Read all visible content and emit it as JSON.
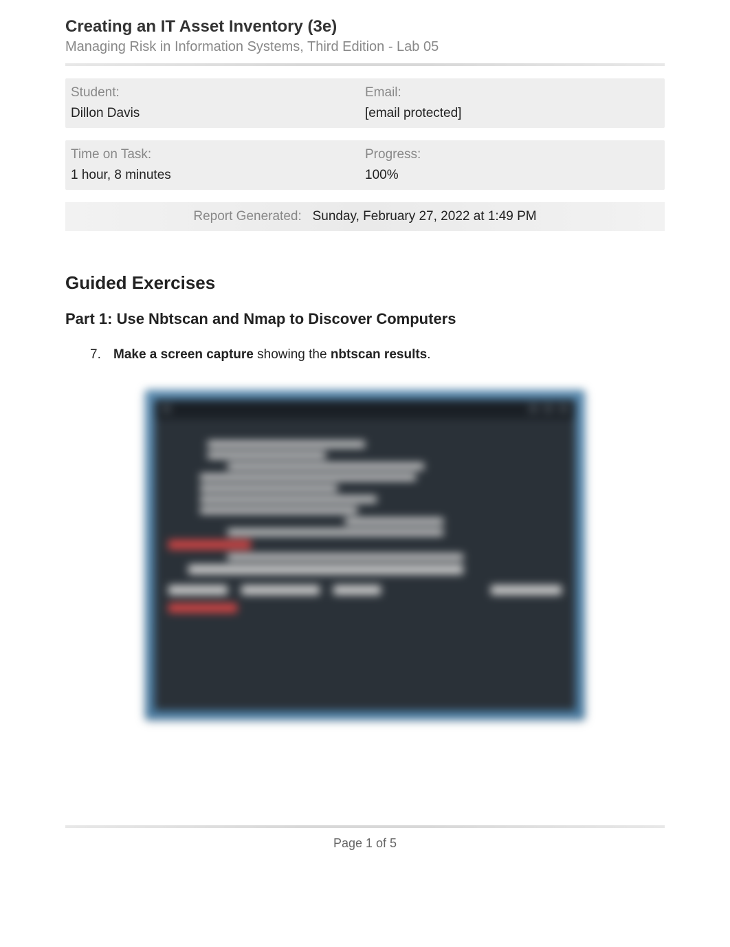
{
  "header": {
    "title": "Creating an IT Asset Inventory (3e)",
    "subtitle": "Managing Risk in Information Systems, Third Edition - Lab 05"
  },
  "student_info": {
    "student_label": "Student:",
    "student_value": "Dillon Davis",
    "email_label": "Email:",
    "email_value": "[email protected]",
    "time_label": "Time on Task:",
    "time_value": "1 hour, 8 minutes",
    "progress_label": "Progress:",
    "progress_value": "100%"
  },
  "report": {
    "label": "Report Generated:",
    "value": "Sunday, February 27, 2022 at 1:49 PM"
  },
  "section": {
    "heading": "Guided Exercises",
    "part_heading": "Part 1: Use Nbtscan and Nmap to Discover Computers"
  },
  "exercise": {
    "number": "7.",
    "bold1": "Make a screen capture",
    "mid": " showing the ",
    "bold2": "nbtscan results",
    "end": "."
  },
  "footer": {
    "page": "Page 1 of 5"
  }
}
